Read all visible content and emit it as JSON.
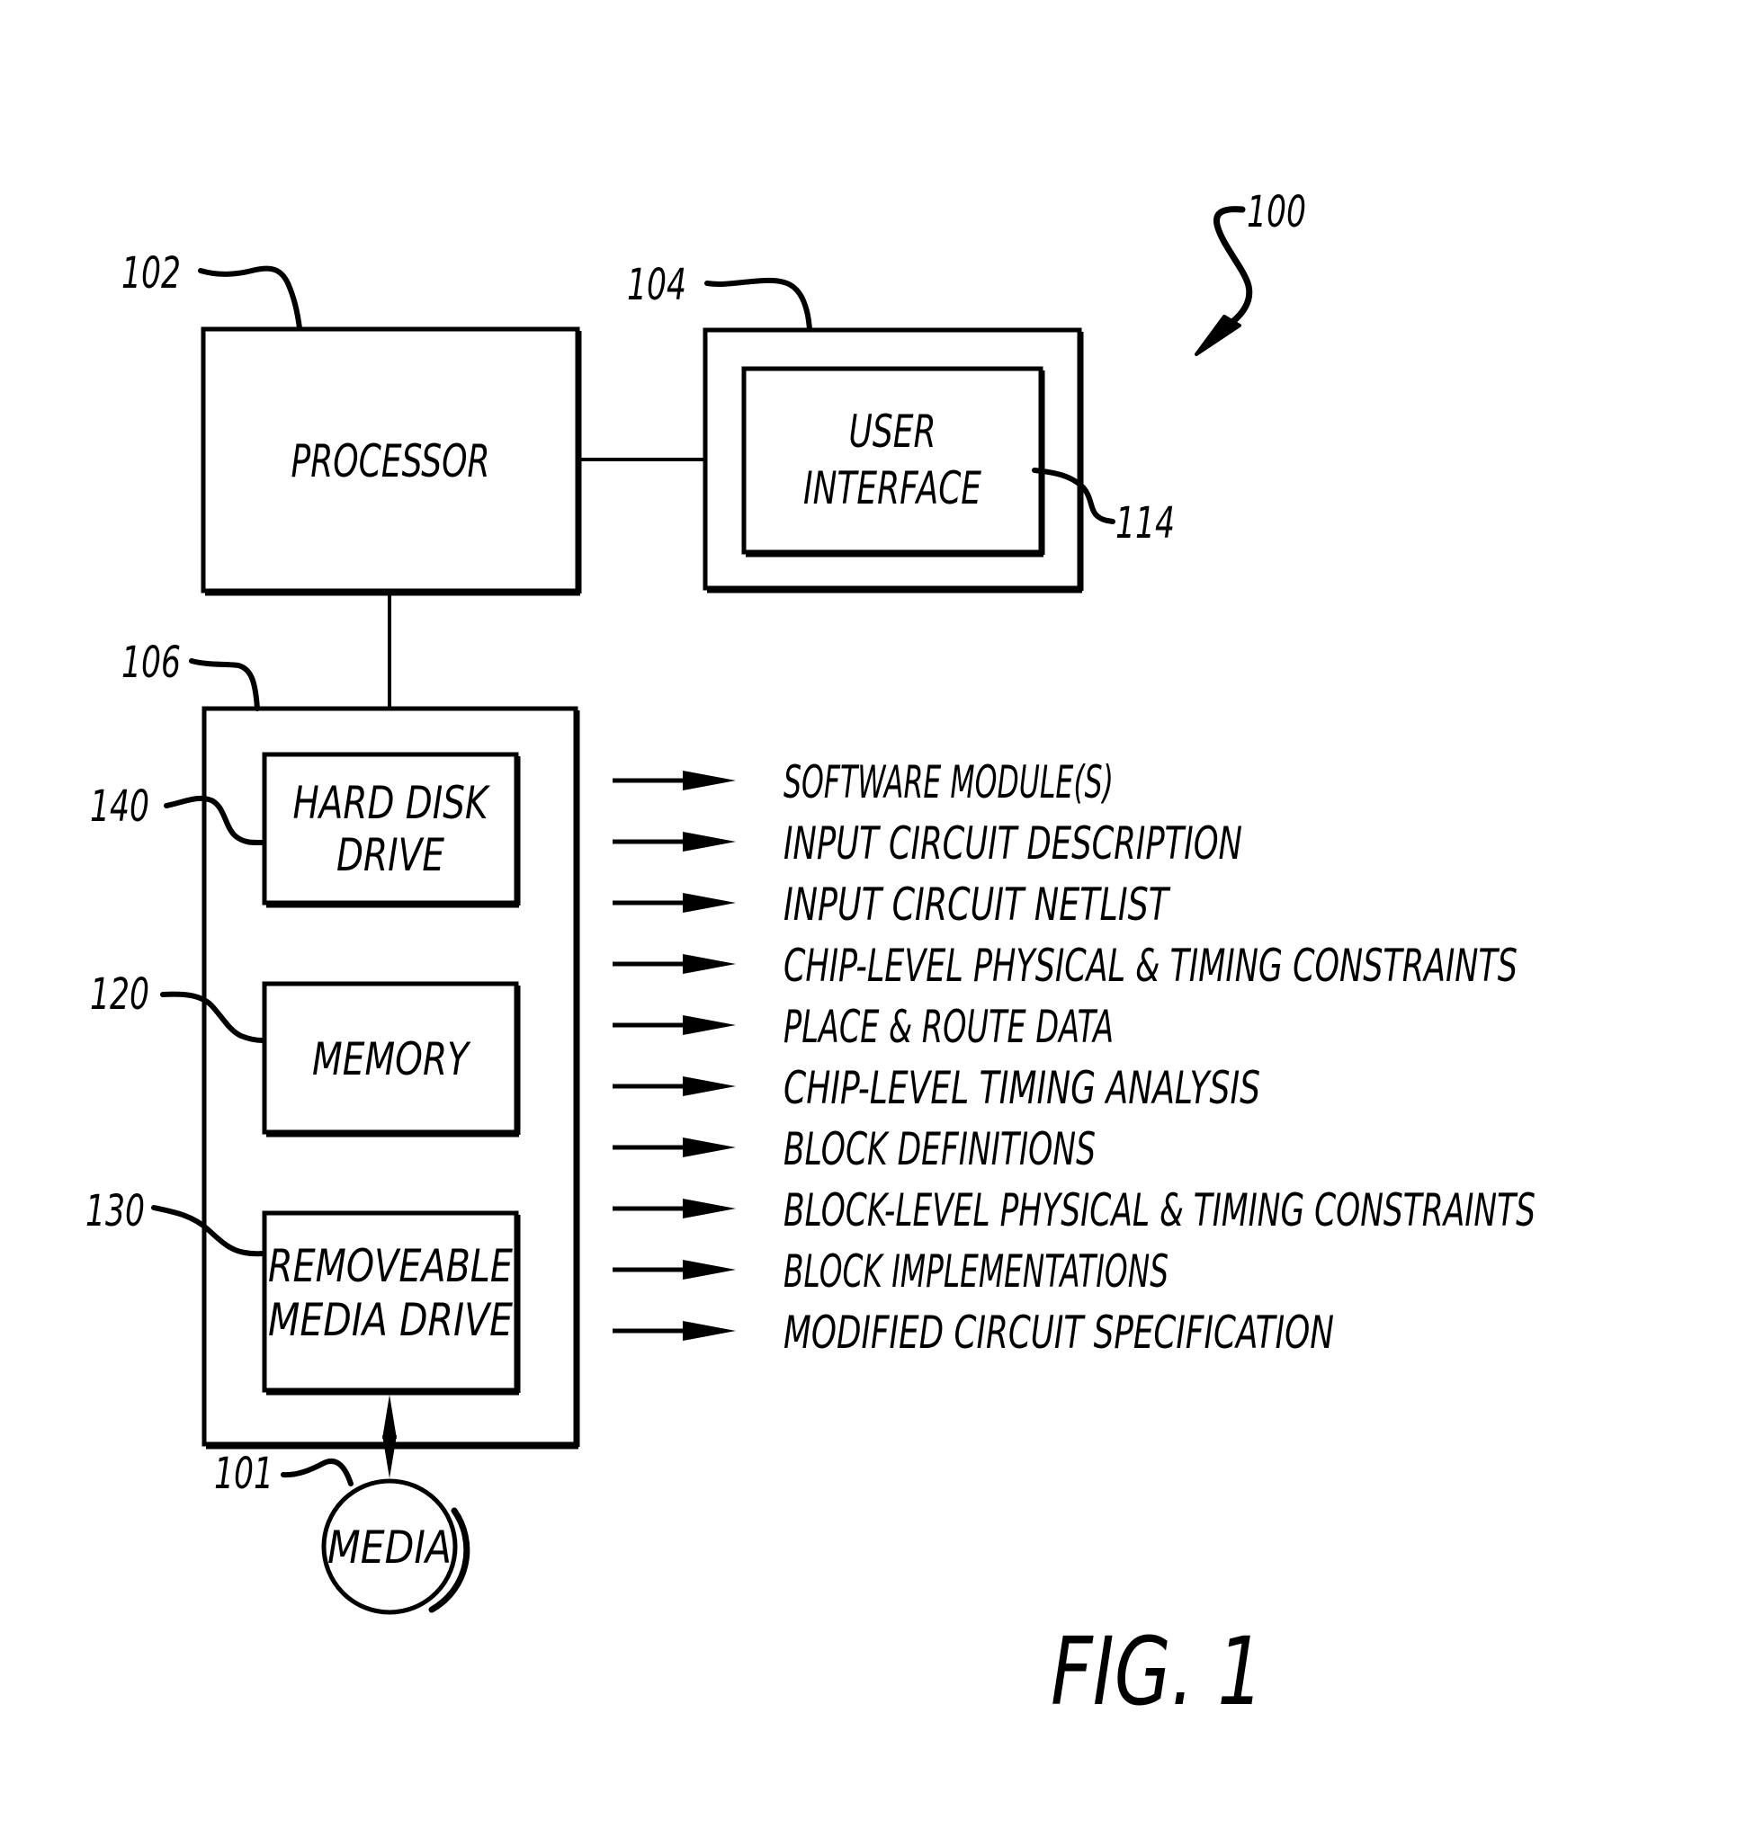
{
  "figure": {
    "caption": "FIG. 1",
    "system_ref": "100"
  },
  "blocks": {
    "processor": {
      "ref": "102",
      "label": "PROCESSOR"
    },
    "ui_outer": {
      "ref": "104"
    },
    "user_interface": {
      "ref": "114",
      "lines": [
        "USER",
        "INTERFACE"
      ]
    },
    "storage": {
      "ref": "106"
    },
    "hard_disk": {
      "ref": "140",
      "lines": [
        "HARD DISK",
        "DRIVE"
      ]
    },
    "memory": {
      "ref": "120",
      "lines": [
        "MEMORY"
      ]
    },
    "removable": {
      "ref": "130",
      "lines": [
        "REMOVEABLE",
        "MEDIA DRIVE"
      ]
    },
    "media": {
      "ref": "101",
      "label": "MEDIA"
    }
  },
  "stored_items": [
    "SOFTWARE MODULE(S)",
    "INPUT CIRCUIT DESCRIPTION",
    "INPUT CIRCUIT NETLIST",
    "CHIP-LEVEL PHYSICAL & TIMING CONSTRAINTS",
    "PLACE & ROUTE DATA",
    "CHIP-LEVEL TIMING ANALYSIS",
    "BLOCK DEFINITIONS",
    "BLOCK-LEVEL PHYSICAL & TIMING CONSTRAINTS",
    "BLOCK IMPLEMENTATIONS",
    "MODIFIED CIRCUIT SPECIFICATION"
  ],
  "colors": {
    "ink": "#000000",
    "paper": "#ffffff"
  }
}
